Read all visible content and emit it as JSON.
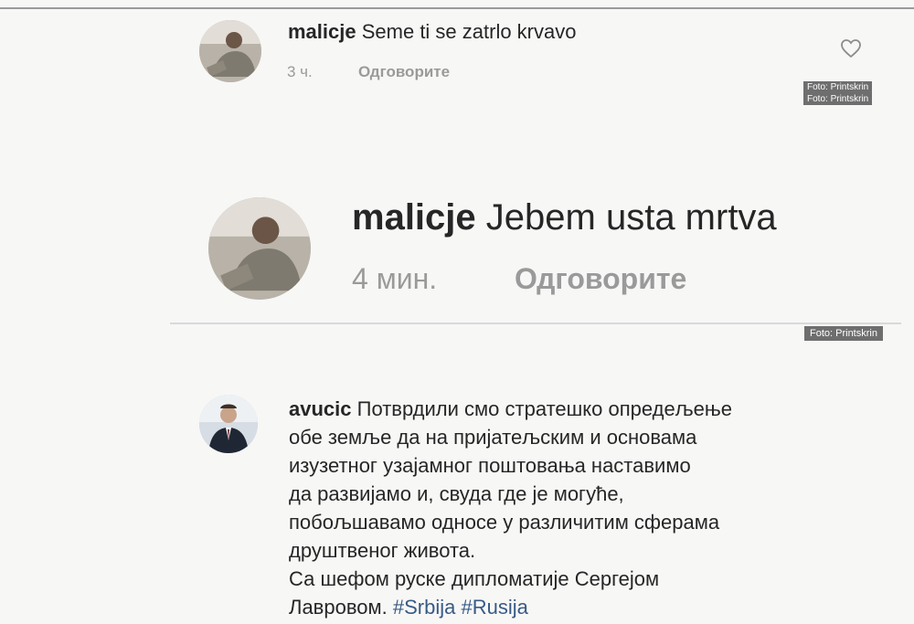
{
  "comments": [
    {
      "username": "malicje",
      "text": "Seme ti se zatrlo krvavo",
      "time": "3 ч.",
      "reply_label": "Одговорите"
    },
    {
      "username": "malicje",
      "text": "Jebem usta mrtva",
      "time": "4 мин.",
      "reply_label": "Одговорите"
    },
    {
      "username": "avucic",
      "lines": [
        "Потврдили смо стратешко опредељење",
        "обе земље да на пријатељским и основама",
        "изузетног узајамног поштовања наставимо",
        "да развијамо и, свуда где је могуће,",
        "побољшавамо односе у различитим сферама",
        "друштвеног живота.",
        "Са шефом руске дипломатије Сергејом"
      ],
      "last_line_text": "Лавровом.",
      "hashtags": [
        "#Srbija",
        "#Rusija"
      ]
    }
  ],
  "credits": {
    "credit_1": "Foto: Printskrin",
    "credit_2": "Foto: Printskrin",
    "credit_3": "Foto: Printskrin"
  },
  "icons": {
    "like": "heart-outline-icon"
  }
}
